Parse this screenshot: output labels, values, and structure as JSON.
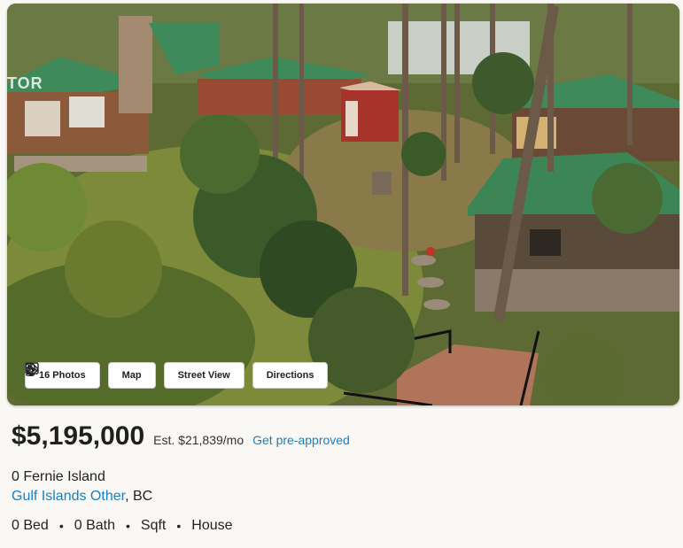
{
  "photo": {
    "watermark": "TOR",
    "buttons": {
      "photos": "16 Photos",
      "map": "Map",
      "street_view": "Street View",
      "directions": "Directions"
    }
  },
  "listing": {
    "price": "$5,195,000",
    "estimate": "Est. $21,839/mo",
    "preapproved_link": "Get pre-approved",
    "address_line1": "0 Fernie Island",
    "city": "Gulf Islands Other",
    "province_suffix": ", BC",
    "beds": "0 Bed",
    "baths": "0 Bath",
    "sqft": "Sqft",
    "type": "House"
  },
  "colors": {
    "accent": "#1a7fbf",
    "roof_green": "#3e8a5a",
    "cabin_red": "#a8332b"
  }
}
